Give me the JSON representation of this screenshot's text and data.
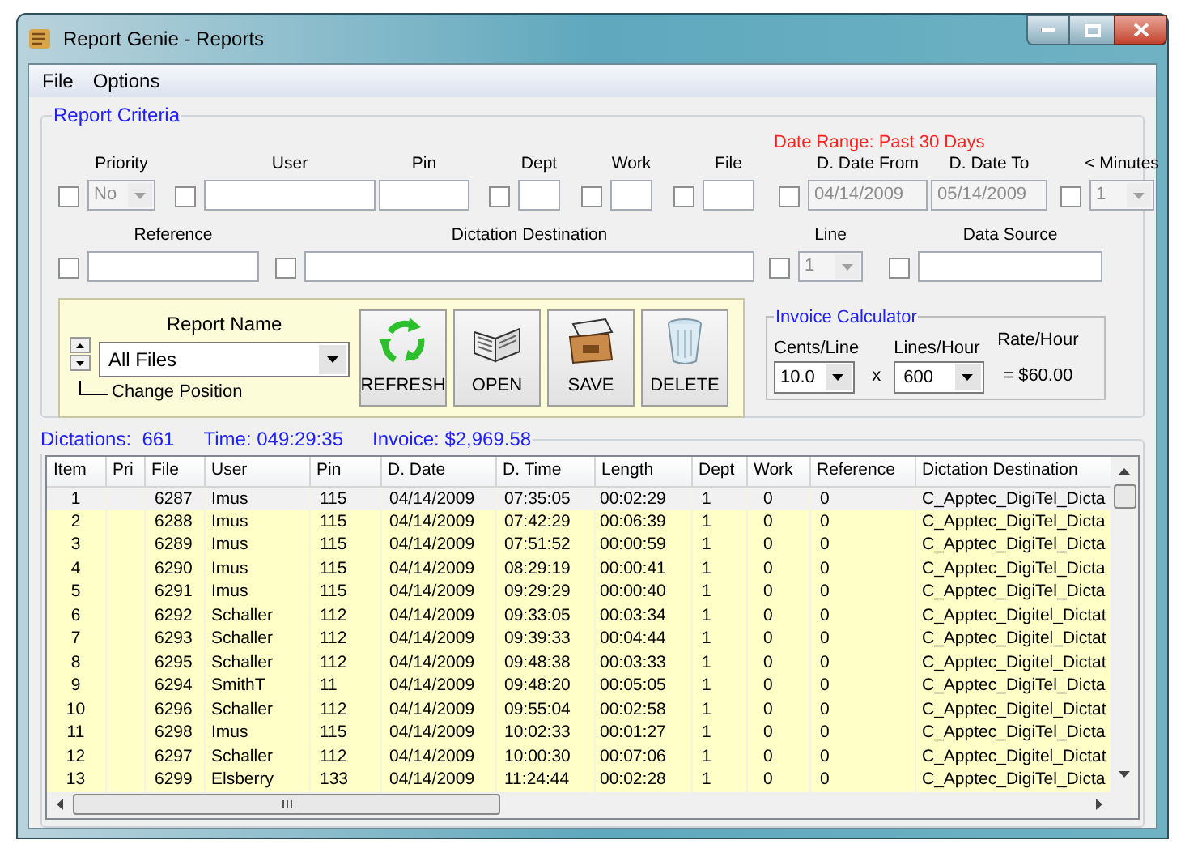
{
  "window": {
    "title": "Report Genie - Reports"
  },
  "menu": [
    "File",
    "Options"
  ],
  "criteria": {
    "title": "Report Criteria",
    "date_range": "Date Range:  Past 30 Days",
    "filters": [
      {
        "label": "Priority",
        "kind": "combo",
        "value": "No",
        "checked": false,
        "disabled": true
      },
      {
        "label": "User",
        "kind": "text",
        "checked": false
      },
      {
        "label": "Pin",
        "kind": "text"
      },
      {
        "label": "Dept",
        "kind": "text",
        "checked": false
      },
      {
        "label": "Work",
        "kind": "text",
        "checked": false
      },
      {
        "label": "File",
        "kind": "text",
        "checked": false
      },
      {
        "label": "D. Date From",
        "kind": "text",
        "value": "04/14/2009",
        "checked": false,
        "disabled": true
      },
      {
        "label": "D. Date To",
        "kind": "text",
        "value": "05/14/2009",
        "disabled": true
      },
      {
        "label": "< Minutes",
        "kind": "combo",
        "value": "1",
        "checked": false,
        "disabled": true
      }
    ],
    "filters_2": [
      {
        "label": "Reference",
        "kind": "text",
        "checked": false
      },
      {
        "label": "Dictation Destination",
        "kind": "text",
        "checked": false
      },
      {
        "label": "Line",
        "kind": "combo",
        "value": "1",
        "checked": false,
        "disabled": true
      },
      {
        "label": "Data Source",
        "kind": "text",
        "checked": false
      }
    ]
  },
  "report": {
    "label": "Report Name",
    "value": "All Files",
    "position_hint": "Change Position",
    "buttons": [
      {
        "label": "REFRESH",
        "kind": "refresh"
      },
      {
        "label": "OPEN",
        "kind": "open"
      },
      {
        "label": "SAVE",
        "kind": "save"
      },
      {
        "label": "DELETE",
        "kind": "delete"
      }
    ]
  },
  "invoice": {
    "title": "Invoice Calculator",
    "cents_label": "Cents/Line",
    "cents": "10.0",
    "times": "x",
    "lines_label": "Lines/Hour",
    "lines": "600",
    "rate_label": "Rate/Hour",
    "rate": "= $60.00"
  },
  "summary": [
    "Dictations:  661",
    "Time: 049:29:35",
    "Invoice: $2,969.58"
  ],
  "table": {
    "columns": [
      "Item",
      "Pri",
      "File",
      "User",
      "Pin",
      "D. Date",
      "D. Time",
      "Length",
      "Dept",
      "Work",
      "Reference",
      "Dictation Destination"
    ],
    "rows": [
      {
        "selected": true,
        "cells": [
          "1",
          "",
          "6287",
          "Imus",
          "115",
          "04/14/2009",
          "07:35:05",
          "00:02:29",
          "1",
          "0",
          "0",
          "C_Apptec_DigiTel_Dicta"
        ]
      },
      {
        "selected": false,
        "cells": [
          "2",
          "",
          "6288",
          "Imus",
          "115",
          "04/14/2009",
          "07:42:29",
          "00:06:39",
          "1",
          "0",
          "0",
          "C_Apptec_DigiTel_Dicta"
        ]
      },
      {
        "selected": false,
        "cells": [
          "3",
          "",
          "6289",
          "Imus",
          "115",
          "04/14/2009",
          "07:51:52",
          "00:00:59",
          "1",
          "0",
          "0",
          "C_Apptec_DigiTel_Dicta"
        ]
      },
      {
        "selected": false,
        "cells": [
          "4",
          "",
          "6290",
          "Imus",
          "115",
          "04/14/2009",
          "08:29:19",
          "00:00:41",
          "1",
          "0",
          "0",
          "C_Apptec_DigiTel_Dicta"
        ]
      },
      {
        "selected": false,
        "cells": [
          "5",
          "",
          "6291",
          "Imus",
          "115",
          "04/14/2009",
          "09:29:29",
          "00:00:40",
          "1",
          "0",
          "0",
          "C_Apptec_DigiTel_Dicta"
        ]
      },
      {
        "selected": false,
        "cells": [
          "6",
          "",
          "6292",
          "Schaller",
          "112",
          "04/14/2009",
          "09:33:05",
          "00:03:34",
          "1",
          "0",
          "0",
          "C_Apptec_Digitel_Dictat"
        ]
      },
      {
        "selected": false,
        "cells": [
          "7",
          "",
          "6293",
          "Schaller",
          "112",
          "04/14/2009",
          "09:39:33",
          "00:04:44",
          "1",
          "0",
          "0",
          "C_Apptec_Digitel_Dictat"
        ]
      },
      {
        "selected": false,
        "cells": [
          "8",
          "",
          "6295",
          "Schaller",
          "112",
          "04/14/2009",
          "09:48:38",
          "00:03:33",
          "1",
          "0",
          "0",
          "C_Apptec_Digitel_Dictat"
        ]
      },
      {
        "selected": false,
        "cells": [
          "9",
          "",
          "6294",
          "SmithT",
          "11",
          "04/14/2009",
          "09:48:20",
          "00:05:05",
          "1",
          "0",
          "0",
          "C_Apptec_DigiTel_Dicta"
        ]
      },
      {
        "selected": false,
        "cells": [
          "10",
          "",
          "6296",
          "Schaller",
          "112",
          "04/14/2009",
          "09:55:04",
          "00:02:58",
          "1",
          "0",
          "0",
          "C_Apptec_Digitel_Dictat"
        ]
      },
      {
        "selected": false,
        "cells": [
          "11",
          "",
          "6298",
          "Imus",
          "115",
          "04/14/2009",
          "10:02:33",
          "00:01:27",
          "1",
          "0",
          "0",
          "C_Apptec_DigiTel_Dicta"
        ]
      },
      {
        "selected": false,
        "cells": [
          "12",
          "",
          "6297",
          "Schaller",
          "112",
          "04/14/2009",
          "10:00:30",
          "00:07:06",
          "1",
          "0",
          "0",
          "C_Apptec_Digitel_Dictat"
        ]
      },
      {
        "selected": false,
        "cells": [
          "13",
          "",
          "6299",
          "Elsberry",
          "133",
          "04/14/2009",
          "11:24:44",
          "00:02:28",
          "1",
          "0",
          "0",
          "C_Apptec_DigiTel_Dicta"
        ]
      }
    ]
  }
}
